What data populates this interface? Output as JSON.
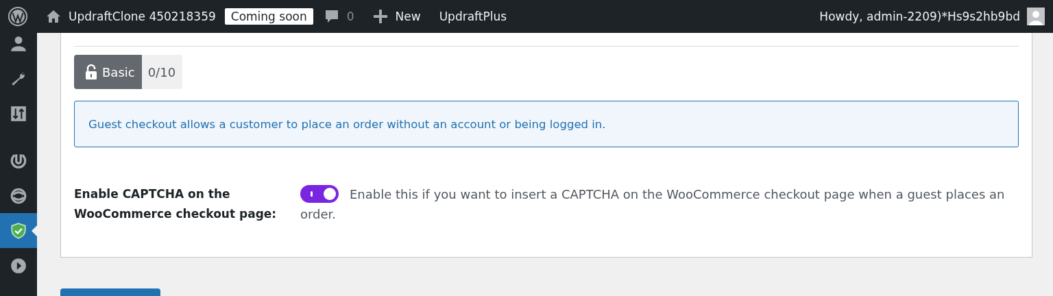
{
  "admin_bar": {
    "site_name": "UpdraftClone 450218359",
    "status_badge": "Coming soon",
    "comments_count": "0",
    "new_label": "New",
    "plugin_link": "UpdraftPlus",
    "greeting": "Howdy, admin-2209)*Hs9s2hb9bd"
  },
  "sidebar": {
    "items": [
      {
        "selected": false
      },
      {
        "selected": false
      },
      {
        "selected": false
      },
      {
        "selected": false
      },
      {
        "selected": false
      },
      {
        "selected": true
      },
      {
        "selected": false
      }
    ]
  },
  "level_badge": {
    "label": "Basic",
    "score": "0/10"
  },
  "notice": "Guest checkout allows a customer to place an order without an account or being logged in.",
  "setting": {
    "label": "Enable CAPTCHA on the WooCommerce checkout page:",
    "on": true,
    "description": "Enable this if you want to insert a CAPTCHA on the WooCommerce checkout page when a guest places an order."
  }
}
